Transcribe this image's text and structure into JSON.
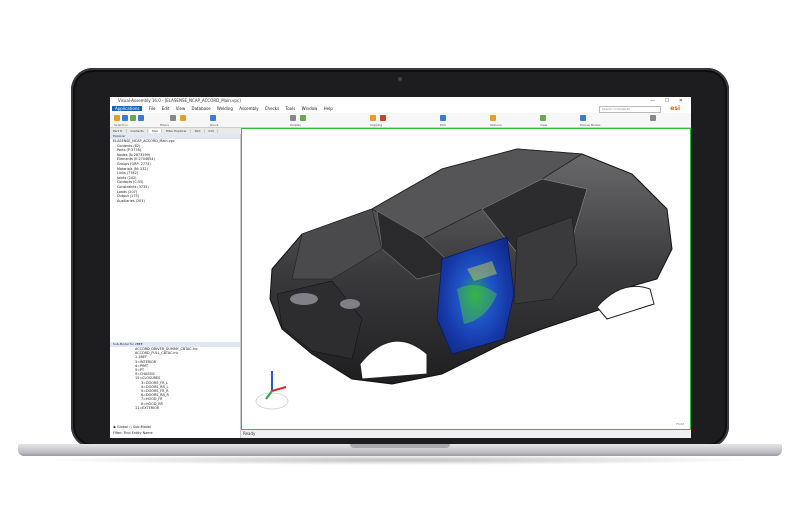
{
  "app": {
    "title": "Visual-Assembly 16.0 - [ELASENSE_NCAP_ACCORD_Main.vpc]",
    "window_controls": "— ☐ ✕",
    "menu": [
      "Applications",
      "File",
      "Edit",
      "View",
      "Database",
      "Welding",
      "Assembly",
      "Checks",
      "Tools",
      "Window",
      "Help"
    ],
    "search_placeholder": "Search commands",
    "brand": "esi",
    "ribbon_groups": [
      "Selection",
      "Filters",
      "Quick",
      "Display",
      "Clipping",
      "Pick",
      "Options",
      "View",
      "Labels",
      "Options",
      "Utility",
      "Edges",
      "Mouse Modes"
    ],
    "tabs": [
      "Part Tr",
      "Contacts",
      "Stat",
      "Filter Explorer",
      "Part",
      "Info"
    ],
    "explorer_title": "Explorer",
    "tree": [
      "ELASENSE_NCAP_ACCORD_Main.vpc",
      "Contents (82)",
      "Parts (P:3778)",
      "Nodes (N:2873299)",
      "Elements (E:2704654)",
      "Groups (GRP: 2774)",
      "Materials (M: 232)",
      "Links (7782)",
      "Joints (202)",
      "Contacts (C:55)",
      "Constraints (3735)",
      "Loads (207)",
      "Output (175)",
      "Auxiliaries (203)"
    ],
    "submodel_title": "Sub-Model  for 2BEE",
    "submodel_tree": [
      "ACCORD_DRIVER_DUMMY_CBTAC.inc",
      "ACCORD_FULL_CBTAC.inc",
      "1-2BEF",
      "3=INTERIOR",
      "4=PIMT",
      "5=PT",
      "9=CHASSIS",
      "15=CLOSURES",
      "3=DOORS_FR_L",
      "4=DOORS_RR_L",
      "5=DOORS_FR_R",
      "6=DOORS_RR_R",
      "7=HOOD_FR",
      "8=HOOD_RR",
      "11=EXTERIOR"
    ],
    "options": [
      "Global",
      "Sub-Model",
      "Filter:",
      "Find",
      "Entity Name"
    ],
    "status": "Ready",
    "viewport_label": "Front"
  }
}
